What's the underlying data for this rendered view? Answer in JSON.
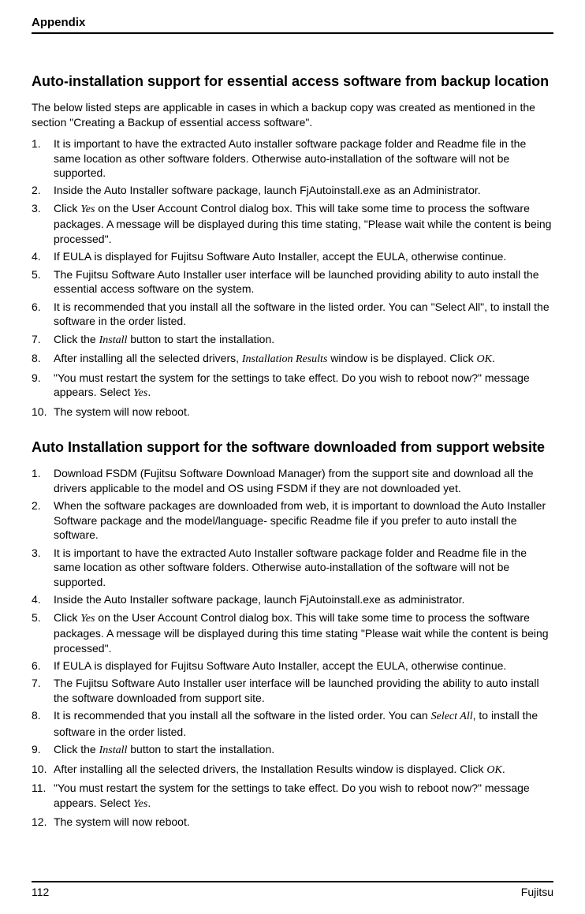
{
  "header": {
    "title": "Appendix"
  },
  "section1": {
    "heading": "Auto-installation support for essential access software from backup location",
    "intro": "The below listed steps are applicable in cases in which a backup copy was created as mentioned in the section \"Creating a Backup of essential access software\".",
    "items": [
      "It is important to have the extracted Auto installer software package folder and Readme file in the same location as other software folders. Otherwise auto-installation of the software will not be supported.",
      "Inside the Auto Installer software package, launch FjAutoinstall.exe as an Administrator.",
      "Click |Yes| on the User Account Control dialog box. This will take some time to process the software packages. A message will be displayed during this time stating, \"Please wait while the content is being processed\".",
      "If EULA is displayed for Fujitsu Software Auto Installer, accept the EULA, otherwise continue.",
      "The Fujitsu Software Auto Installer user interface will be launched providing ability to auto install the essential access software on the system.",
      "It is recommended that you install all the software in the listed order. You can \"Select All\", to install the software in the order listed.",
      "Click the |Install| button to start the installation.",
      "After installing all the selected drivers, |Installation Results| window is be displayed. Click |OK|.",
      "\"You must restart the system for the settings to take effect. Do you wish to reboot now?\" message appears. Select |Yes|.",
      "The system will now reboot."
    ]
  },
  "section2": {
    "heading": "Auto Installation support for the software downloaded from support website",
    "items": [
      "Download FSDM (Fujitsu Software Download Manager) from the support site and download all the drivers applicable to the model and OS using FSDM if they are not downloaded yet.",
      "When the software packages are downloaded from web, it is important to download the Auto Installer Software package and the model/language- specific Readme file if you prefer to auto install the software.",
      "It is important to have the extracted Auto Installer software package folder and Readme file in the same location as other software folders. Otherwise auto-installation of the software will not be supported.",
      "Inside the Auto Installer software package, launch FjAutoinstall.exe as administrator.",
      "Click |Yes| on the User Account Control dialog box. This will take some time to process the software packages. A message will be displayed during this time stating \"Please wait while the content is being processed\".",
      "If EULA is displayed for Fujitsu Software Auto Installer, accept the EULA, otherwise continue.",
      "The Fujitsu Software Auto Installer user interface will be launched providing the ability to auto install the software downloaded from support site.",
      "It is recommended that you install all the software in the listed order. You can |Select All|, to install the software in the order listed.",
      "Click the |Install| button to start the installation.",
      "After installing all the selected drivers, the Installation Results window is displayed. Click |OK|.",
      "\"You must restart the system for the settings to take effect. Do you wish to reboot now?\" message appears. Select |Yes|.",
      "The system will now reboot."
    ]
  },
  "footer": {
    "page": "112",
    "brand": "Fujitsu"
  }
}
